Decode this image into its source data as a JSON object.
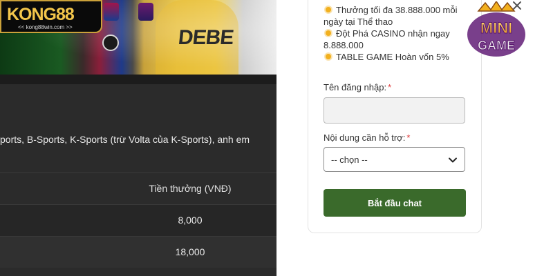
{
  "site": {
    "logo": {
      "brand": "KONG88",
      "url": "<< kong88win.com >>"
    },
    "banner_text": "DEBE",
    "description": "ports, B-Sports, K-Sports (trừ Volta của K-Sports), anh em",
    "table": {
      "header": "Tiền thưởng (VNĐ)",
      "rows": [
        "8,000",
        "18,000"
      ]
    }
  },
  "chat": {
    "promo_lines": [
      "Thưởng tối đa 38.888.000 mỗi",
      "ngày tại Thể thao",
      "Đột Phá CASINO nhận ngay",
      "8.888.000",
      "TABLE GAME Hoàn vốn 5%"
    ],
    "form": {
      "username_label": "Tên đăng nhập:",
      "username_value": "",
      "support_label": "Nội dung cần hỗ trợ:",
      "support_selected": "-- chọn --",
      "required_mark": "*",
      "submit_label": "Bắt đầu chat"
    },
    "accent_color": "#3a6a2b"
  },
  "mini_game": {
    "line1": "MINI",
    "line2": "GAME"
  }
}
